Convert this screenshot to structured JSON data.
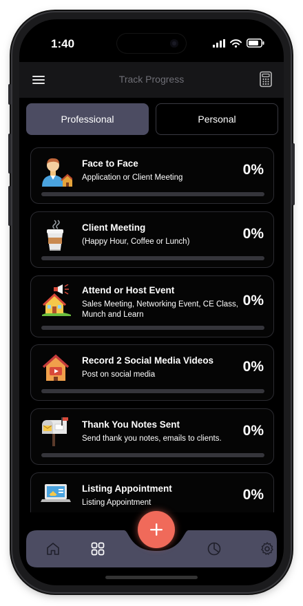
{
  "status_bar": {
    "time": "1:40"
  },
  "header": {
    "title": "Track Progress",
    "menu_icon": "hamburger-menu-icon",
    "right_icon": "calculator-icon"
  },
  "tabs": [
    {
      "label": "Professional",
      "active": true
    },
    {
      "label": "Personal",
      "active": false
    }
  ],
  "activities": [
    {
      "title": "Face to Face",
      "subtitle": "Application or Client Meeting",
      "percent_label": "0%",
      "progress": 0,
      "icon": "person-house-icon"
    },
    {
      "title": "Client Meeting",
      "subtitle": "(Happy Hour, Coffee or Lunch)",
      "percent_label": "0%",
      "progress": 0,
      "icon": "coffee-cup-icon"
    },
    {
      "title": "Attend or Host Event",
      "subtitle": "Sales Meeting, Networking Event, CE Class, Munch and Learn",
      "percent_label": "0%",
      "progress": 0,
      "icon": "house-megaphone-icon"
    },
    {
      "title": "Record 2 Social Media Videos",
      "subtitle": "Post on social media",
      "percent_label": "0%",
      "progress": 0,
      "icon": "house-video-icon"
    },
    {
      "title": "Thank You Notes Sent",
      "subtitle": "Send thank you notes, emails to clients.",
      "percent_label": "0%",
      "progress": 0,
      "icon": "mailbox-icon"
    },
    {
      "title": "Listing Appointment",
      "subtitle": "Listing Appointment",
      "percent_label": "0%",
      "progress": 0,
      "icon": "laptop-listing-icon"
    }
  ],
  "bottom_nav": {
    "items": [
      "home-icon",
      "grid-icon",
      "pie-chart-icon",
      "settings-gear-icon"
    ],
    "fab_icon": "plus-icon"
  },
  "colors": {
    "background": "#000000",
    "tab_active": "#4c4c62",
    "accent": "#f06a5a",
    "nav_bar": "#4c4c62",
    "progress_track": "#35353b"
  }
}
